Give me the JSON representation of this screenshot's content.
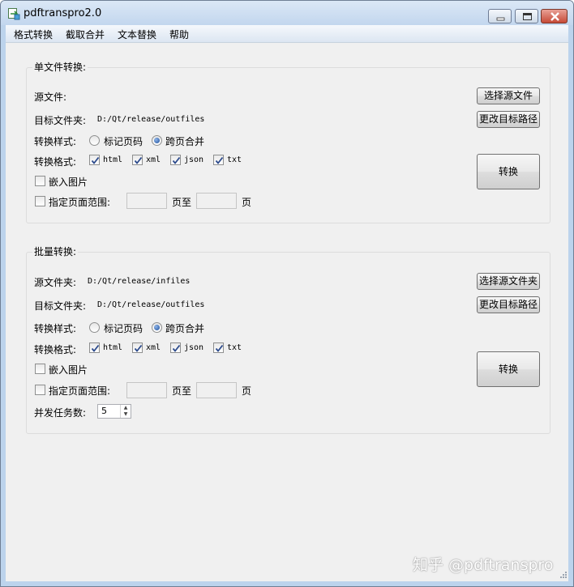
{
  "window": {
    "title": "pdftranspro2.0",
    "icon": "app-icon"
  },
  "menu": [
    {
      "label": "格式转换"
    },
    {
      "label": "截取合并"
    },
    {
      "label": "文本替换"
    },
    {
      "label": "帮助"
    }
  ],
  "single": {
    "title": "单文件转换:",
    "source_label": "源文件:",
    "select_source_button": "选择源文件",
    "target_label": "目标文件夹:",
    "target_path": "D:/Qt/release/outfiles",
    "change_target_button": "更改目标路径",
    "style_label": "转换样式:",
    "style_options": [
      {
        "label": "标记页码",
        "selected": false
      },
      {
        "label": "跨页合并",
        "selected": true
      }
    ],
    "format_label": "转换格式:",
    "formats": [
      {
        "label": "html",
        "checked": true
      },
      {
        "label": "xml",
        "checked": true
      },
      {
        "label": "json",
        "checked": true
      },
      {
        "label": "txt",
        "checked": true
      }
    ],
    "embed_images_label": "嵌入图片",
    "embed_images_checked": false,
    "page_range_label": "指定页面范围:",
    "page_range_checked": false,
    "page_from_value": "",
    "page_to_text": "页至",
    "page_end_text": "页",
    "page_to_value": "",
    "convert_button": "转换"
  },
  "batch": {
    "title": "批量转换:",
    "source_label": "源文件夹:",
    "source_path": "D:/Qt/release/infiles",
    "select_source_button": "选择源文件夹",
    "target_label": "目标文件夹:",
    "target_path": "D:/Qt/release/outfiles",
    "change_target_button": "更改目标路径",
    "style_label": "转换样式:",
    "style_options": [
      {
        "label": "标记页码",
        "selected": false
      },
      {
        "label": "跨页合并",
        "selected": true
      }
    ],
    "format_label": "转换格式:",
    "formats": [
      {
        "label": "html",
        "checked": true
      },
      {
        "label": "xml",
        "checked": true
      },
      {
        "label": "json",
        "checked": true
      },
      {
        "label": "txt",
        "checked": true
      }
    ],
    "embed_images_label": "嵌入图片",
    "embed_images_checked": false,
    "page_range_label": "指定页面范围:",
    "page_range_checked": false,
    "page_from_value": "",
    "page_to_text": "页至",
    "page_end_text": "页",
    "page_to_value": "",
    "concurrency_label": "并发任务数:",
    "concurrency_value": "5",
    "convert_button": "转换"
  },
  "watermark": "知乎 @pdftranspro",
  "colors": {
    "accent": "#1d4f9c",
    "close_button": "#c74a37",
    "client_bg": "#f0f0f0"
  }
}
